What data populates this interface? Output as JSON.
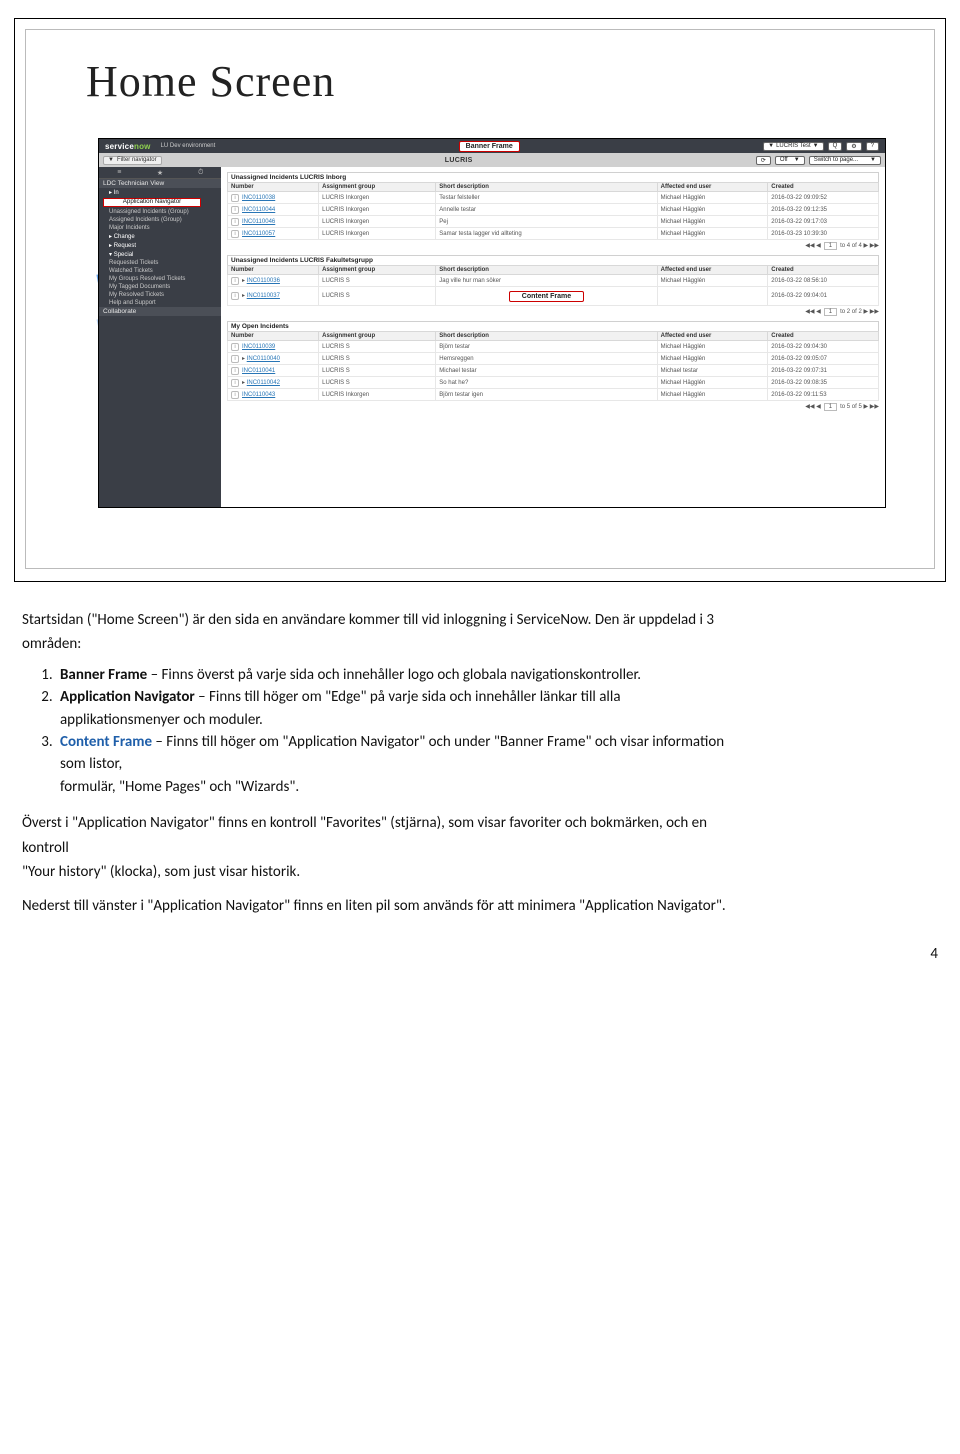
{
  "shot": {
    "title": "Home Screen",
    "bar1": {
      "brand_prefix": "service",
      "brand_suffix": "now",
      "env": "LU Dev environment",
      "banner_callout": "Banner Frame",
      "user": "LUCRIS Test",
      "icons": [
        "Q",
        "⚙",
        "?"
      ]
    },
    "bar2": {
      "filter_icon": "▼",
      "filter_text": "Filter navigator",
      "center": "LUCRIS",
      "refresh": "⟳",
      "off": "Off",
      "switch": "Switch to page..."
    },
    "nav": {
      "btns": [
        "≡",
        "★",
        "⏱"
      ],
      "header1": "LDC Technician View",
      "app_nav_callout": "Application Navigator",
      "items1": [
        "Unassigned Incidents (Group)",
        "Assigned Incidents (Group)",
        "Major Incidents",
        "Change",
        "Request",
        "Special",
        "Requested Tickets",
        "Watched Tickets",
        "My Groups Resolved Tickets",
        "My Tagged Documents",
        "My Resolved Tickets",
        "Help and Support"
      ],
      "header2": "Collaborate"
    },
    "lists": {
      "cols": [
        "Number",
        "Assignment group",
        "Short description",
        "Affected end user",
        "Created"
      ],
      "l1": {
        "title": "Unassigned Incidents LUCRIS Inborg",
        "rows": [
          [
            "INC0110038",
            "LUCRIS Inkorgen",
            "Testar felsteller",
            "Michael Hägglén",
            "2016-03-22 09:09:52"
          ],
          [
            "INC0110044",
            "LUCRIS Inkorgen",
            "Annelle testar",
            "Michael Hägglén",
            "2016-03-22 09:12:35"
          ],
          [
            "INC0110046",
            "LUCRIS Inkorgen",
            "Pej",
            "Michael Hägglén",
            "2016-03-22 09:17:03"
          ],
          [
            "INC0110057",
            "LUCRIS Inkorgen",
            "Samar testa lagger vid allteting",
            "Michael Hägglén",
            "2016-03-23 10:39:30"
          ]
        ],
        "page": "to 4 of 4"
      },
      "l2": {
        "title": "Unassigned Incidents LUCRIS Fakultetsgrupp",
        "rows": [
          [
            "INC0110036",
            "LUCRIS S",
            "Jag ville hur man söker",
            "Michael Hägglén",
            "2016-03-22 08:56:10"
          ],
          [
            "INC0110037",
            "LUCRIS S",
            "",
            "",
            "2016-03-22 09:04:01"
          ]
        ],
        "content_callout": "Content Frame",
        "page": "to 2 of 2"
      },
      "l3": {
        "title": "My Open Incidents",
        "rows": [
          [
            "INC0110039",
            "LUCRIS S",
            "Björn testar",
            "Michael Hägglén",
            "2016-03-22 09:04:30"
          ],
          [
            "INC0110040",
            "LUCRIS S",
            "Hemsreggen",
            "Michael Hägglén",
            "2016-03-22 09:05:07"
          ],
          [
            "INC0110041",
            "LUCRIS S",
            "Michael testar",
            "Michael testar",
            "2016-03-22 09:07:31"
          ],
          [
            "INC0110042",
            "LUCRIS S",
            "So hat he?",
            "Michael Hägglén",
            "2016-03-22 09:08:35"
          ],
          [
            "INC0110043",
            "LUCRIS Inkorgen",
            "Björn testar igen",
            "Michael Hägglén",
            "2016-03-22 09:11:53"
          ]
        ],
        "page": "to 5 of 5"
      },
      "pager": {
        "first": "◀◀",
        "prev": "◀",
        "box": "1",
        "next": "▶",
        "last": "▶▶"
      }
    }
  },
  "doc": {
    "p1a": "Startsidan (\"Home Screen\") är den sida en användare kommer till vid inloggning i ServiceNow. Den är uppdelad i 3",
    "p1b": "områden:",
    "li1_num": "1.",
    "li1_b": "Banner Frame",
    "li1_rest": " – Finns överst på varje sida och innehåller logo och globala navigationskontroller.",
    "li2_num": "2.",
    "li2_b": "Application Navigator",
    "li2_rest_a": " – Finns till höger om \"Edge\" på varje sida och innehåller länkar till alla",
    "li2_rest_b": "applikationsmenyer och moduler.",
    "li3_num": "3.",
    "li3_b": "Content Frame",
    "li3_rest_a": " – Finns till höger om \"Application Navigator\" och under \"Banner Frame\" och visar information",
    "li3_rest_b": "som listor,",
    "li3_rest_c": "formulär, \"Home Pages\" och \"Wizards\".",
    "p2a": "Överst i \"Application Navigator\" finns en kontroll \"Favorites\" (stjärna), som visar favoriter och bokmärken, och en",
    "p2b": "kontroll",
    "p2c": "\"Your history\" (klocka), som just visar historik.",
    "p3": "Nederst till vänster i \"Application Navigator\" finns en liten pil som används för att minimera \"Application Navigator\".",
    "pagenum": "4"
  }
}
